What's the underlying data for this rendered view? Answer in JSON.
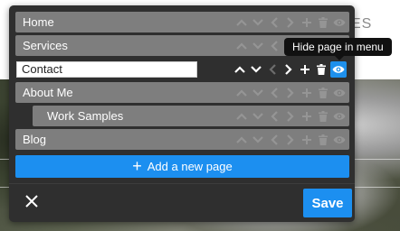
{
  "background": {
    "nav_fragment": "ES"
  },
  "pages": [
    {
      "label": "Home",
      "indent": false,
      "state": "normal"
    },
    {
      "label": "Services",
      "indent": false,
      "state": "normal"
    },
    {
      "label": "Contact",
      "indent": false,
      "state": "editing"
    },
    {
      "label": "About Me",
      "indent": false,
      "state": "normal"
    },
    {
      "label": "Work Samples",
      "indent": true,
      "state": "normal"
    },
    {
      "label": "Blog",
      "indent": false,
      "state": "normal"
    }
  ],
  "tooltip": {
    "text": "Hide page in menu"
  },
  "actions": {
    "add_page_label": "Add a new page",
    "save_label": "Save"
  },
  "icons": {
    "row_icons": [
      "chevron-up-icon",
      "chevron-down-icon",
      "chevron-left-icon",
      "chevron-right-icon",
      "plus-icon",
      "trash-icon",
      "eye-icon"
    ],
    "close": "close-icon"
  },
  "colors": {
    "accent": "#1c8ff0",
    "panel": "#2f2f2f",
    "row": "#7e7e7e"
  }
}
